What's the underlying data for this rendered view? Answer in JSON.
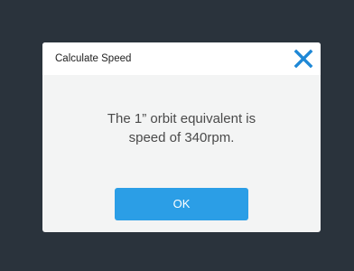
{
  "dialog": {
    "title": "Calculate Speed",
    "close_icon": "close-icon",
    "message_line1": "The 1” orbit equivalent is",
    "message_line2": "speed of 340rpm.",
    "ok_label": "OK"
  },
  "colors": {
    "background": "#2a333c",
    "dialog_body": "#f3f4f4",
    "dialog_header": "#ffffff",
    "accent": "#2b9ee6",
    "close_icon": "#1e88d6"
  }
}
